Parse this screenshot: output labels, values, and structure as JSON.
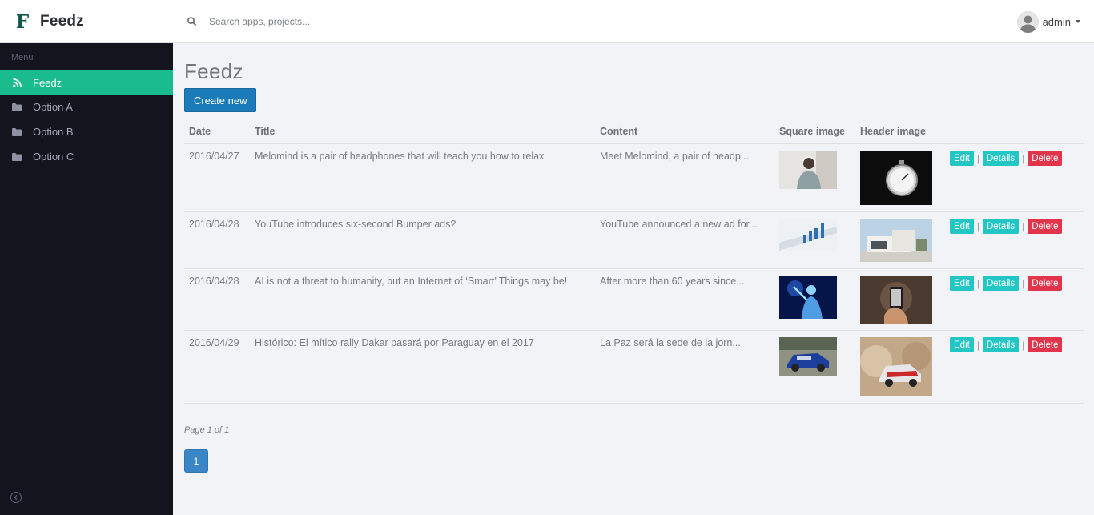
{
  "brand": {
    "letter": "F",
    "name": "Feedz"
  },
  "search": {
    "placeholder": "Search apps, projects..."
  },
  "user": {
    "name": "admin"
  },
  "sidebar": {
    "header": "Menu",
    "items": [
      {
        "label": "Feedz",
        "icon": "rss-icon",
        "active": true
      },
      {
        "label": "Option A",
        "icon": "folder-icon"
      },
      {
        "label": "Option B",
        "icon": "folder-icon"
      },
      {
        "label": "Option C",
        "icon": "folder-icon"
      }
    ]
  },
  "main": {
    "title": "Feedz",
    "create_label": "Create new",
    "columns": [
      "Date",
      "Title",
      "Content",
      "Square image",
      "Header image"
    ],
    "actions": {
      "edit": "Edit",
      "details": "Details",
      "delete": "Delete",
      "separator": "|"
    },
    "rows": [
      {
        "date": "2016/04/27",
        "title": "Melomind is a pair of headphones that will teach you how to relax",
        "content": "Meet Melomind, a pair of headp...",
        "square_image": "person-with-headphones",
        "header_image": "stopwatch"
      },
      {
        "date": "2016/04/28",
        "title": "YouTube introduces six-second Bumper ads?",
        "content": "YouTube announced a new ad for...",
        "square_image": "charts-on-paper",
        "header_image": "modern-house"
      },
      {
        "date": "2016/04/28",
        "title": "AI is not a threat to humanity, but an Internet of ‘Smart’ Things may be!",
        "content": "After more than 60 years since...",
        "square_image": "blue-digital-human",
        "header_image": "hand-holding-phone"
      },
      {
        "date": "2016/04/29",
        "title": "Histórico: El mítico rally Dakar pasará por Paraguay en el 2017",
        "content": "La Paz será la sede de la jorn...",
        "square_image": "rally-car",
        "header_image": "rally-car-dust"
      }
    ],
    "page_info": "Page 1 of 1",
    "current_page": "1"
  },
  "colors": {
    "accent": "#1abc8e",
    "sidebar_bg": "#13141e",
    "primary": "#1b7ab8",
    "info": "#22c6c5",
    "danger": "#e2344b"
  }
}
